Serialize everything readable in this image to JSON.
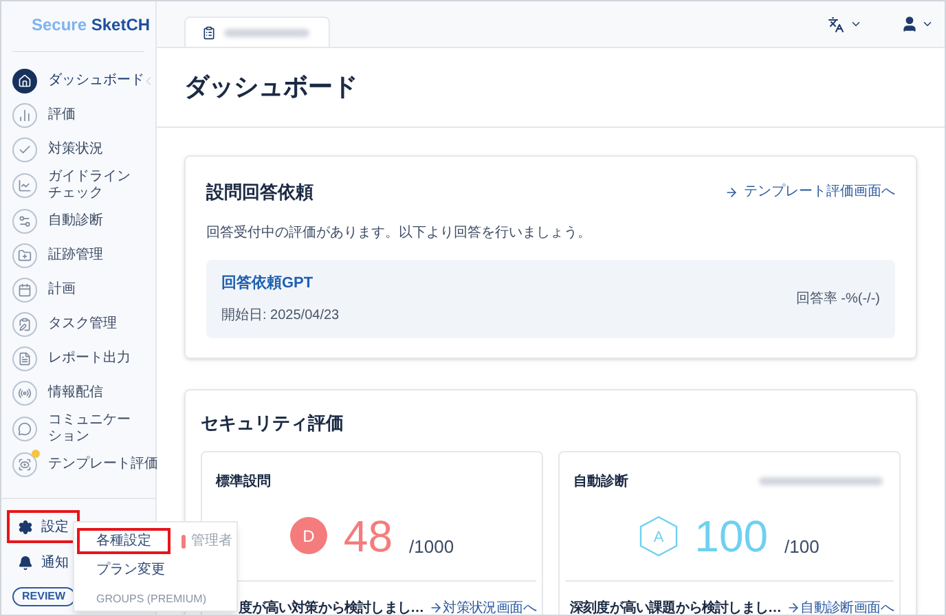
{
  "logo": {
    "text_light": "Secure",
    "text_bold": "SketCH"
  },
  "sidebar": {
    "items": [
      {
        "label": "ダッシュボード",
        "selected": true,
        "badge": false
      },
      {
        "label": "評価",
        "selected": false,
        "badge": false
      },
      {
        "label": "対策状況",
        "selected": false,
        "badge": false
      },
      {
        "label": "ガイドラインチェック",
        "selected": false,
        "badge": false
      },
      {
        "label": "自動診断",
        "selected": false,
        "badge": false
      },
      {
        "label": "証跡管理",
        "selected": false,
        "badge": false
      },
      {
        "label": "計画",
        "selected": false,
        "badge": false
      },
      {
        "label": "タスク管理",
        "selected": false,
        "badge": false
      },
      {
        "label": "レポート出力",
        "selected": false,
        "badge": false
      },
      {
        "label": "情報配信",
        "selected": false,
        "badge": false
      },
      {
        "label": "コミュニケーション",
        "selected": false,
        "badge": false
      },
      {
        "label": "テンプレート評価",
        "selected": false,
        "badge": true
      }
    ],
    "bottom": [
      {
        "kind": "settings",
        "label": "設定",
        "highlighted": true
      },
      {
        "kind": "notify",
        "label": "通知",
        "highlighted": false
      }
    ],
    "review_badge": "REVIEW"
  },
  "settings_menu": {
    "items": [
      {
        "label": "各種設定",
        "highlighted": true
      },
      {
        "label": "プラン変更",
        "highlighted": false
      },
      {
        "label": "GROUPS (PREMIUM)",
        "highlighted": false
      }
    ],
    "role": "管理者"
  },
  "page_title": "ダッシュボード",
  "request_card": {
    "title": "設問回答依頼",
    "link": "テンプレート評価画面へ",
    "message": "回答受付中の評価があります。以下より回答を行いましょう。",
    "item": {
      "name": "回答依頼GPT",
      "start": "開始日: 2025/04/23",
      "rate": "回答率 -%(-/-)"
    }
  },
  "security_card": {
    "title": "セキュリティ評価",
    "panels": [
      {
        "title": "標準設問",
        "grade": "D",
        "kind": "circle",
        "color": "#f47c7c",
        "score": "48",
        "max": "/1000",
        "footer": "度が高い対策から検討しまし…",
        "link": "対策状況画面へ",
        "domain": false
      },
      {
        "title": "自動診断",
        "grade": "A",
        "kind": "hexagon",
        "color": "#6fd0f0",
        "score": "100",
        "max": "/100",
        "footer": "深刻度が高い課題から検討しまし…",
        "link": "自動診断画面へ",
        "domain": true
      }
    ]
  }
}
